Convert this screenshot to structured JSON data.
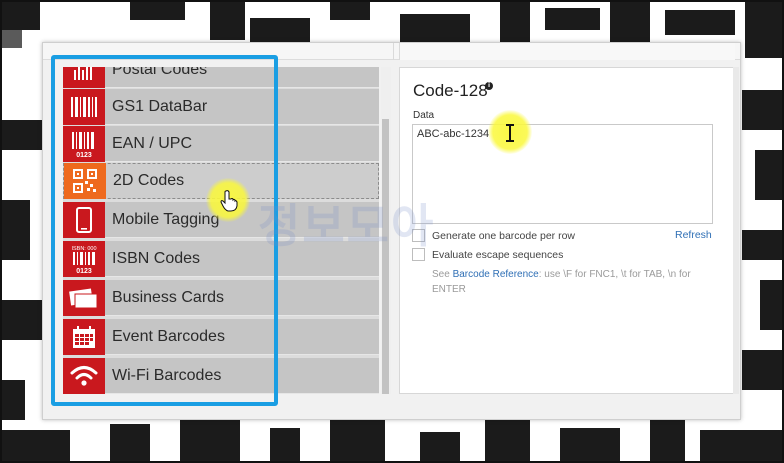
{
  "menu": {
    "items": [
      {
        "label": "Postal Codes",
        "icon": "postal-barcode-icon",
        "active": false
      },
      {
        "label": "GS1 DataBar",
        "icon": "gs1-databar-icon",
        "active": false
      },
      {
        "label": "EAN / UPC",
        "icon": "ean-upc-icon",
        "active": false
      },
      {
        "label": "2D Codes",
        "icon": "qr-code-icon",
        "active": true
      },
      {
        "label": "Mobile Tagging",
        "icon": "smartphone-icon",
        "active": false
      },
      {
        "label": "ISBN Codes",
        "icon": "isbn-barcode-icon",
        "active": false
      },
      {
        "label": "Business Cards",
        "icon": "business-card-icon",
        "active": false
      },
      {
        "label": "Event Barcodes",
        "icon": "calendar-icon",
        "active": false
      },
      {
        "label": "Wi-Fi Barcodes",
        "icon": "wifi-icon",
        "active": false
      }
    ],
    "icon_texts": {
      "ean_digits": "0123",
      "isbn_header": "ISBN: 000",
      "isbn_digits": "0123"
    }
  },
  "panel": {
    "title": "Code-128",
    "info_icon": "info-icon",
    "data_label": "Data",
    "data_value": "ABC-abc-1234",
    "option_one": "Generate one barcode per row",
    "option_two": "Evaluate escape sequences",
    "refresh": "Refresh",
    "hint_prefix": "See ",
    "hint_link": "Barcode Reference",
    "hint_suffix": ": use \\F for FNC1, \\t for TAB, \\n for ENTER"
  },
  "watermark": "정보모아",
  "colors": {
    "icon_red": "#c9181e",
    "icon_orange": "#ee6a1e",
    "highlight_blue": "#1a9ee3",
    "link_blue": "#2f6fb5",
    "cursor_yellow": "#faf83c"
  }
}
